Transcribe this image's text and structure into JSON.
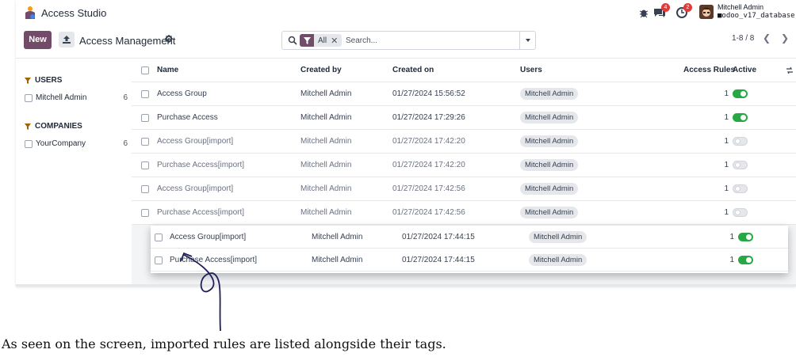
{
  "navbar": {
    "app_title": "Access Studio",
    "chat_badge": "4",
    "activity_badge": "2",
    "user_name": "Mitchell Admin",
    "database": "odoo_v17_database"
  },
  "control": {
    "new_label": "New",
    "breadcrumb": "Access Management",
    "facet_label": "All",
    "search_placeholder": "Search...",
    "pager": "1-8 / 8"
  },
  "sidebar": {
    "groups": [
      {
        "heading": "USERS",
        "items": [
          {
            "label": "Mitchell Admin",
            "count": "6"
          }
        ]
      },
      {
        "heading": "COMPANIES",
        "items": [
          {
            "label": "YourCompany",
            "count": "6"
          }
        ]
      }
    ]
  },
  "table": {
    "columns": [
      "Name",
      "Created by",
      "Created on",
      "Users",
      "Access Rules",
      "Active"
    ],
    "rows": [
      {
        "name": "Access Group",
        "created_by": "Mitchell Admin",
        "created_on": "01/27/2024 15:56:52",
        "users": "Mitchell Admin",
        "access_rules": "1",
        "active": true
      },
      {
        "name": "Purchase Access",
        "created_by": "Mitchell Admin",
        "created_on": "01/27/2024 17:29:26",
        "users": "Mitchell Admin",
        "access_rules": "1",
        "active": true
      },
      {
        "name": "Access Group[import]",
        "created_by": "Mitchell Admin",
        "created_on": "01/27/2024 17:42:20",
        "users": "Mitchell Admin",
        "access_rules": "1",
        "active": false
      },
      {
        "name": "Purchase Access[import]",
        "created_by": "Mitchell Admin",
        "created_on": "01/27/2024 17:42:20",
        "users": "Mitchell Admin",
        "access_rules": "1",
        "active": false
      },
      {
        "name": "Access Group[import]",
        "created_by": "Mitchell Admin",
        "created_on": "01/27/2024 17:42:56",
        "users": "Mitchell Admin",
        "access_rules": "1",
        "active": false
      },
      {
        "name": "Purchase Access[import]",
        "created_by": "Mitchell Admin",
        "created_on": "01/27/2024 17:42:56",
        "users": "Mitchell Admin",
        "access_rules": "1",
        "active": false
      }
    ],
    "highlighted_rows": [
      {
        "name": "Access Group[import]",
        "created_by": "Mitchell Admin",
        "created_on": "01/27/2024 17:44:15",
        "users": "Mitchell Admin",
        "access_rules": "1",
        "active": true
      },
      {
        "name": "Purchase Access[import]",
        "created_by": "Mitchell Admin",
        "created_on": "01/27/2024 17:44:15",
        "users": "Mitchell Admin",
        "access_rules": "1",
        "active": true
      }
    ]
  },
  "caption": "As seen on the screen, imported rules are listed alongside their tags.",
  "colors": {
    "brand": "#714b67",
    "toggle_on": "#28a745",
    "badge": "#e53935",
    "arrow": "#1f1f5a"
  }
}
